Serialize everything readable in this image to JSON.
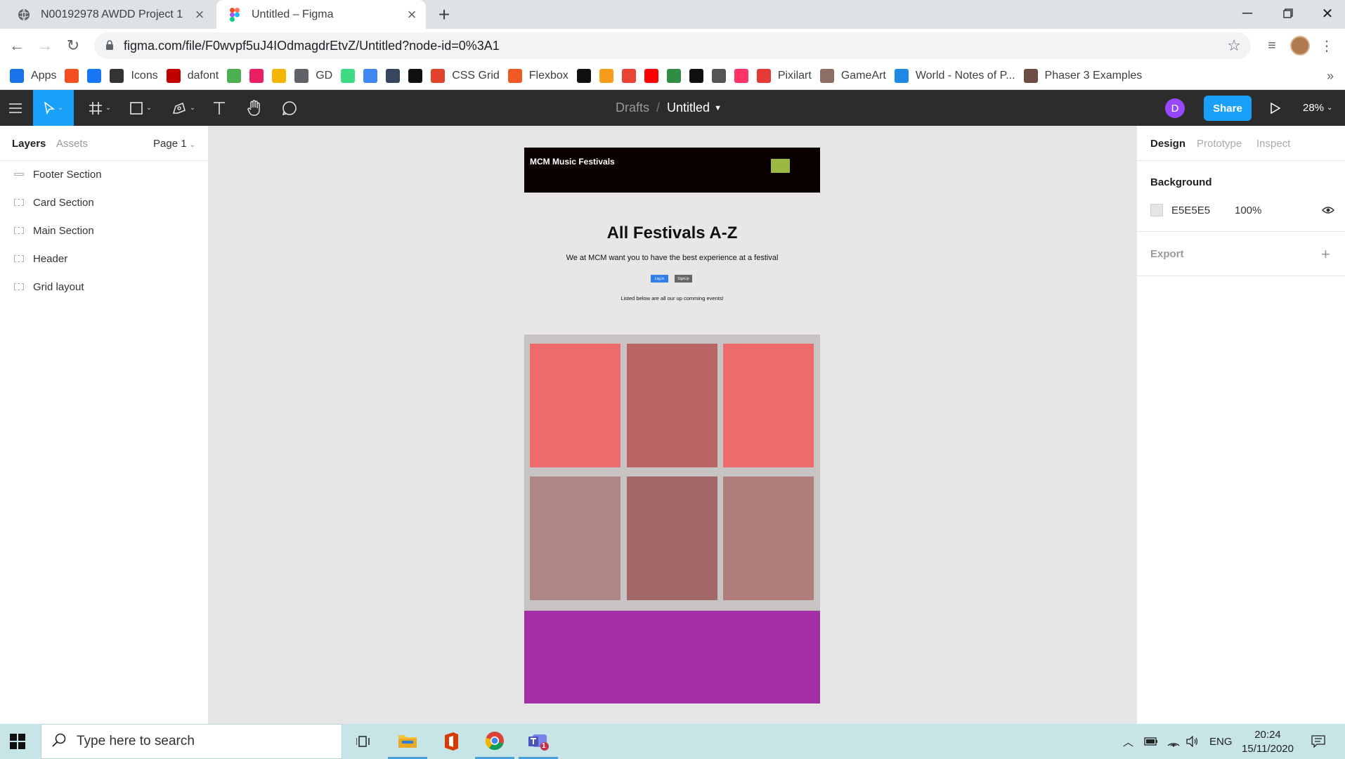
{
  "browser": {
    "tabs": [
      {
        "title": "N00192978 AWDD Project 1",
        "favicon": "globe-icon",
        "active": false
      },
      {
        "title": "Untitled – Figma",
        "favicon": "figma-icon",
        "active": true
      }
    ],
    "new_tab": "+",
    "url": "figma.com/file/F0wvpf5uJ4IOdmagdrEtvZ/Untitled?node-id=0%3A1",
    "bookmarks": [
      {
        "label": "Apps",
        "icon": "apps-grid-icon",
        "color": "#1a73e8"
      },
      {
        "label": "",
        "icon": "microsoft-icon",
        "color": "#f25022"
      },
      {
        "label": "",
        "icon": "f-icon",
        "color": "#1877f2"
      },
      {
        "label": "Icons",
        "icon": "icons-site-icon",
        "color": "#333333"
      },
      {
        "label": "dafont",
        "icon": "dafont-icon",
        "color": "#c00000"
      },
      {
        "label": "",
        "icon": "w3-icon",
        "color": "#4caf50"
      },
      {
        "label": "",
        "icon": "color-grid-icon",
        "color": "#e91e63"
      },
      {
        "label": "",
        "icon": "palette-icon",
        "color": "#f4b400"
      },
      {
        "label": "GD",
        "icon": "globe-icon",
        "color": "#5f6368"
      },
      {
        "label": "",
        "icon": "android-icon",
        "color": "#3ddc84"
      },
      {
        "label": "",
        "icon": "google-icon",
        "color": "#4285f4"
      },
      {
        "label": "",
        "icon": "tumblr-icon",
        "color": "#36465d"
      },
      {
        "label": "",
        "icon": "codepen-icon",
        "color": "#111111"
      },
      {
        "label": "CSS Grid",
        "icon": "css-grid-icon",
        "color": "#e2432a"
      },
      {
        "label": "Flexbox",
        "icon": "flexbox-icon",
        "color": "#f15a24"
      },
      {
        "label": "",
        "icon": "z-icon",
        "color": "#111111"
      },
      {
        "label": "",
        "icon": "puzzle-icon",
        "color": "#f79c1d"
      },
      {
        "label": "",
        "icon": "gmail-icon",
        "color": "#ea4335"
      },
      {
        "label": "",
        "icon": "youtube-icon",
        "color": "#ff0000"
      },
      {
        "label": "",
        "icon": "geeksforgeeks-icon",
        "color": "#2f8d46"
      },
      {
        "label": "",
        "icon": "github-icon",
        "color": "#111111"
      },
      {
        "label": "",
        "icon": "apple-icon",
        "color": "#555555"
      },
      {
        "label": "",
        "icon": "invision-icon",
        "color": "#ff3366"
      },
      {
        "label": "Pixilart",
        "icon": "pixilart-icon",
        "color": "#e53935"
      },
      {
        "label": "GameArt",
        "icon": "gameart-icon",
        "color": "#8d6e63"
      },
      {
        "label": "World - Notes of P...",
        "icon": "world-puzzle-icon",
        "color": "#1e88e5"
      },
      {
        "label": "Phaser 3 Examples",
        "icon": "phaser-icon",
        "color": "#6d4c41"
      }
    ],
    "bookmarks_more": "»"
  },
  "figma": {
    "breadcrumb_drafts": "Drafts",
    "breadcrumb_sep": "/",
    "file_name": "Untitled",
    "user_initial": "D",
    "share_label": "Share",
    "zoom": "28%",
    "left_panel": {
      "tab_layers": "Layers",
      "tab_assets": "Assets",
      "page": "Page 1",
      "layers": [
        {
          "name": "Footer Section",
          "kind": "rect"
        },
        {
          "name": "Card Section",
          "kind": "frame"
        },
        {
          "name": "Main Section",
          "kind": "frame"
        },
        {
          "name": "Header",
          "kind": "frame"
        },
        {
          "name": "Grid layout",
          "kind": "frame"
        }
      ]
    },
    "right_panel": {
      "tab_design": "Design",
      "tab_prototype": "Prototype",
      "tab_inspect": "Inspect",
      "background_label": "Background",
      "background_hex": "E5E5E5",
      "background_opacity": "100%",
      "export_label": "Export",
      "help": "?"
    },
    "design": {
      "brand": "MCM Music Festivals",
      "title": "All Festivals A-Z",
      "subtitle": "We at MCM want you to have the best experience at a festival",
      "login": "Log in",
      "signup": "SignUp",
      "listed": "Listed below are all our up comming events!",
      "colors": {
        "header": "#0a0000",
        "logo": "#9bb843",
        "main": "#e8e6e6",
        "card_section": "#c8c4c4",
        "footer": "#a32ea5"
      },
      "cards": [
        "#ee6b6b",
        "#bb6464",
        "#ee6b6b",
        "#ad8785",
        "#a36968",
        "#b07d7a"
      ]
    }
  },
  "taskbar": {
    "search_placeholder": "Type here to search",
    "apps": [
      "task-view-icon",
      "file-explorer-icon",
      "office-icon",
      "chrome-icon",
      "teams-icon"
    ],
    "teams_badge": "1",
    "language": "ENG",
    "time": "20:24",
    "date": "15/11/2020"
  }
}
